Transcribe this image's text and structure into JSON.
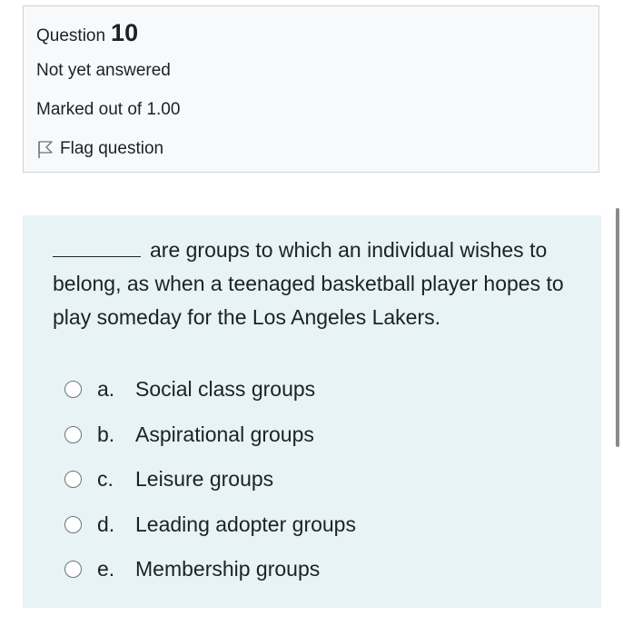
{
  "info": {
    "question_label": "Question",
    "question_number": "10",
    "state": "Not yet answered",
    "grade": "Marked out of 1.00",
    "flag_label": "Flag question",
    "flag_icon": "flag-outline-icon"
  },
  "question": {
    "blank": "________",
    "text": "are groups to which an individual wishes to belong, as when a teenaged basketball player hopes to play someday for the Los Angeles Lakers."
  },
  "options": [
    {
      "letter": "a.",
      "label": "Social class groups",
      "selected": false
    },
    {
      "letter": "b.",
      "label": "Aspirational groups",
      "selected": false
    },
    {
      "letter": "c.",
      "label": "Leisure groups",
      "selected": false
    },
    {
      "letter": "d.",
      "label": "Leading adopter groups",
      "selected": false
    },
    {
      "letter": "e.",
      "label": "Membership groups",
      "selected": false
    }
  ],
  "colors": {
    "info_background": "#f8f9fa",
    "info_border": "#cfd3d6",
    "question_background": "#e7f3f5",
    "text": "#1d2125"
  }
}
